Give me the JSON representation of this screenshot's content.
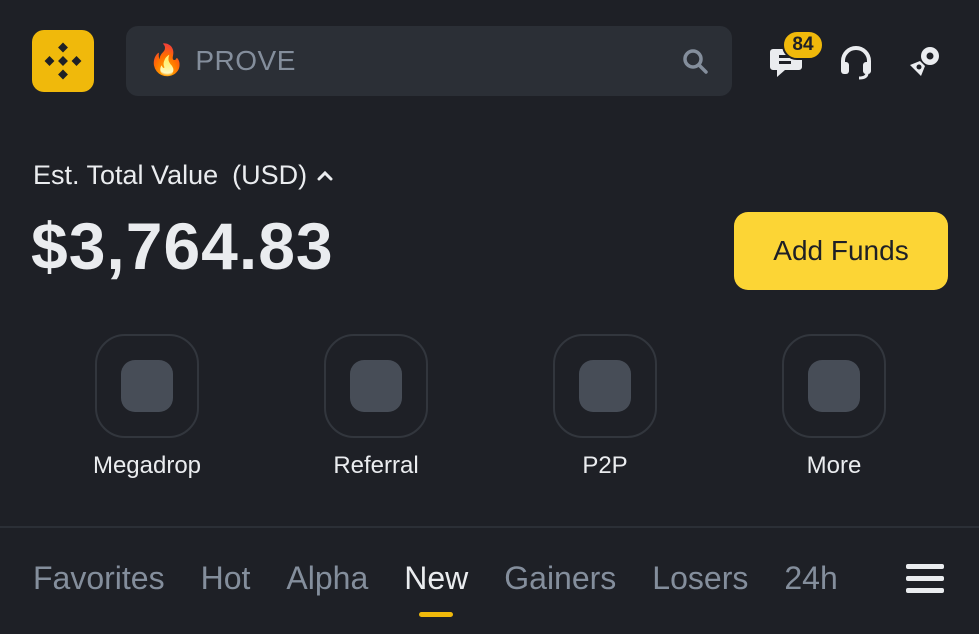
{
  "header": {
    "search_term": "PROVE",
    "search_icon": "search-icon",
    "trending_icon": "fire-icon",
    "messages_badge": "84",
    "icons": [
      "logo-icon",
      "messages-icon",
      "support-headset-icon",
      "connect-icon"
    ]
  },
  "balance": {
    "label": "Est. Total Value",
    "currency": "(USD)",
    "amount": "$3,764.83",
    "add_funds_label": "Add Funds"
  },
  "quick_actions": [
    {
      "label": "Megadrop"
    },
    {
      "label": "Referral"
    },
    {
      "label": "P2P"
    },
    {
      "label": "More"
    }
  ],
  "market_tabs": [
    {
      "label": "Favorites",
      "active": false
    },
    {
      "label": "Hot",
      "active": false
    },
    {
      "label": "Alpha",
      "active": false
    },
    {
      "label": "New",
      "active": true
    },
    {
      "label": "Gainers",
      "active": false
    },
    {
      "label": "Losers",
      "active": false
    },
    {
      "label": "24h",
      "active": false
    }
  ],
  "colors": {
    "background": "#1e2026",
    "accent": "#f0b90b",
    "button": "#fcd535",
    "muted_text": "#848e9c"
  }
}
